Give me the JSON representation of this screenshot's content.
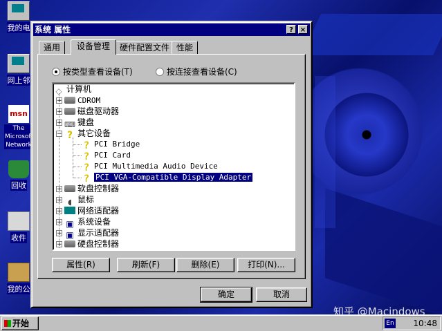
{
  "desktop": {
    "icons": [
      {
        "label": "我的电"
      },
      {
        "label": "网上邻"
      },
      {
        "label": "The Microsoft Network"
      },
      {
        "label": "回收"
      },
      {
        "label": "收件"
      },
      {
        "label": "我的公"
      }
    ],
    "watermark": "知乎 @Macindows"
  },
  "dialog": {
    "title": "系统 属性",
    "help_button": "?",
    "close_button": "×",
    "tabs": [
      "通用",
      "设备管理",
      "硬件配置文件",
      "性能"
    ],
    "active_tab": "设备管理",
    "view_options": [
      {
        "label": "按类型查看设备(T)",
        "selected": true
      },
      {
        "label": "按连接查看设备(C)",
        "selected": false
      }
    ],
    "tree": {
      "root": "计算机",
      "items": [
        {
          "label": "CDROM",
          "expander": "+"
        },
        {
          "label": "磁盘驱动器",
          "expander": "+"
        },
        {
          "label": "键盘",
          "expander": "+"
        },
        {
          "label": "其它设备",
          "expander": "−"
        },
        {
          "label": "PCI Bridge"
        },
        {
          "label": "PCI Card"
        },
        {
          "label": "PCI Multimedia Audio Device"
        },
        {
          "label": "PCI VGA-Compatible Display Adapter",
          "selected": true
        },
        {
          "label": "软盘控制器",
          "expander": "+"
        },
        {
          "label": "鼠标",
          "expander": "+"
        },
        {
          "label": "网络适配器",
          "expander": "+"
        },
        {
          "label": "系统设备",
          "expander": "+"
        },
        {
          "label": "显示适配器",
          "expander": "+"
        },
        {
          "label": "硬盘控制器",
          "expander": "+"
        }
      ]
    },
    "buttons": {
      "properties": "属性(R)",
      "refresh": "刷新(F)",
      "remove": "删除(E)",
      "print": "打印(N)...",
      "ok": "确定",
      "cancel": "取消"
    }
  },
  "taskbar": {
    "start": "开始",
    "lang": "En",
    "clock": "10:48"
  }
}
